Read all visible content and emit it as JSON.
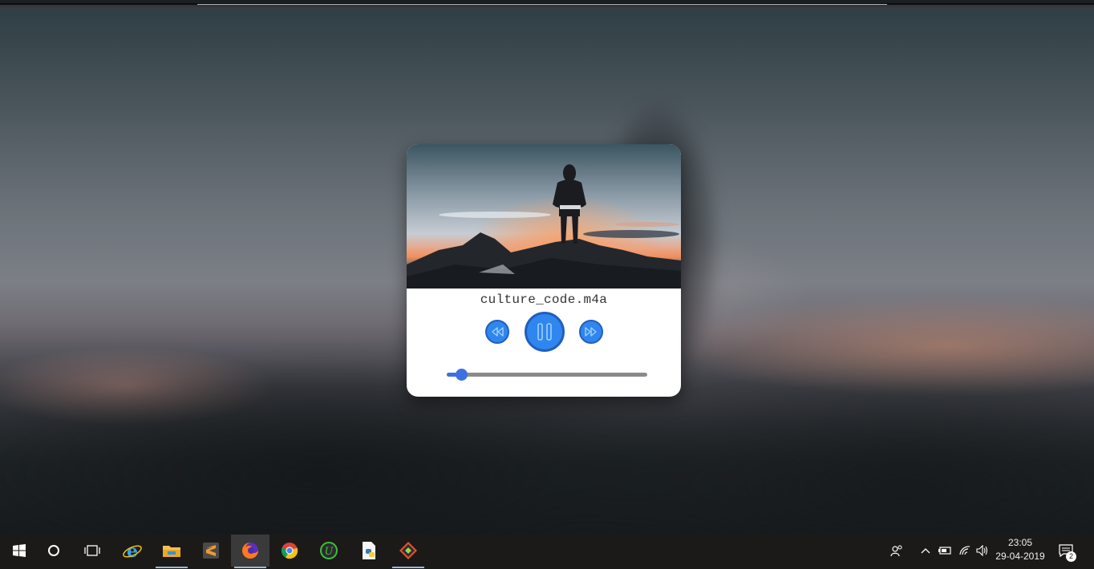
{
  "player": {
    "track_title": "culture_code.m4a",
    "state": "playing",
    "progress_fraction": 0.07,
    "accent_color": "#2f86ee",
    "progress_color": "#3d6fe0",
    "controls": {
      "prev_icon": "rewind-icon",
      "play_pause_icon": "pause-icon",
      "next_icon": "fast-forward-icon"
    }
  },
  "taskbar": {
    "items": [
      {
        "name": "start",
        "icon": "windows-logo-icon"
      },
      {
        "name": "search",
        "icon": "cortana-circle-icon"
      },
      {
        "name": "task-view",
        "icon": "task-view-icon"
      },
      {
        "name": "internet-explorer",
        "icon": "internet-explorer-icon"
      },
      {
        "name": "file-explorer",
        "icon": "folder-icon"
      },
      {
        "name": "sublime-text",
        "icon": "sublime-text-icon"
      },
      {
        "name": "firefox",
        "icon": "firefox-icon"
      },
      {
        "name": "chrome",
        "icon": "chrome-icon"
      },
      {
        "name": "upwork",
        "icon": "upwork-icon"
      },
      {
        "name": "python-file",
        "icon": "python-file-icon"
      },
      {
        "name": "git",
        "icon": "git-icon"
      }
    ],
    "tray_icons": [
      "people-icon",
      "chevron-up-icon",
      "battery-icon",
      "wifi-icon",
      "speaker-icon",
      "action-center-icon"
    ],
    "clock": {
      "time": "23:05",
      "date": "29-04-2019"
    },
    "notification_count": "2"
  }
}
